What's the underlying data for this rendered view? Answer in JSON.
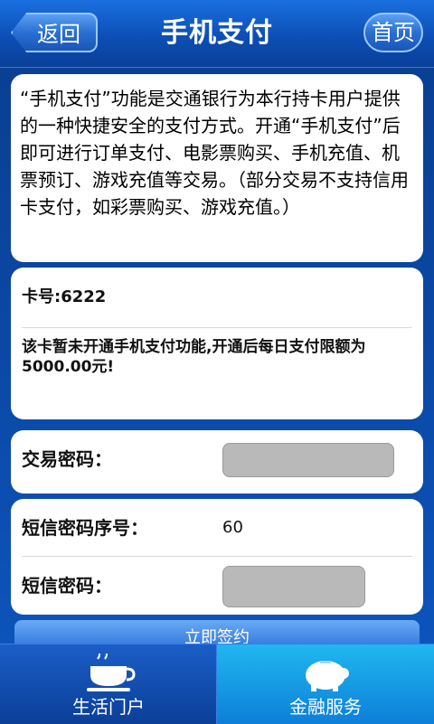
{
  "header": {
    "back_label": "返回",
    "title": "手机支付",
    "home_label": "首页"
  },
  "intro_text": "“手机支付”功能是交通银行为本行持卡用户提供的一种快捷安全的支付方式。开通“手机支付”后即可进行订单支付、电影票购买、手机充值、机票预订、游戏充值等交易。（部分交易不支持信用卡支付，如彩票购买、游戏充值。）",
  "card": {
    "card_number": "卡号:6222",
    "notice": "该卡暂未开通手机支付功能,开通后每日支付限额为5000.00元!"
  },
  "form": {
    "trade_password_label": "交易密码：",
    "sms_seq_label": "短信密码序号：",
    "sms_seq_value": "60",
    "sms_password_label": "短信密码："
  },
  "action": {
    "label": "立即签约"
  },
  "tabs": [
    {
      "label": "生活门户",
      "icon": "cup-icon"
    },
    {
      "label": "金融服务",
      "icon": "piggy-bank-icon"
    }
  ],
  "colors": {
    "brand_blue": "#0d4fb6",
    "tab_active": "#20b7f0"
  }
}
